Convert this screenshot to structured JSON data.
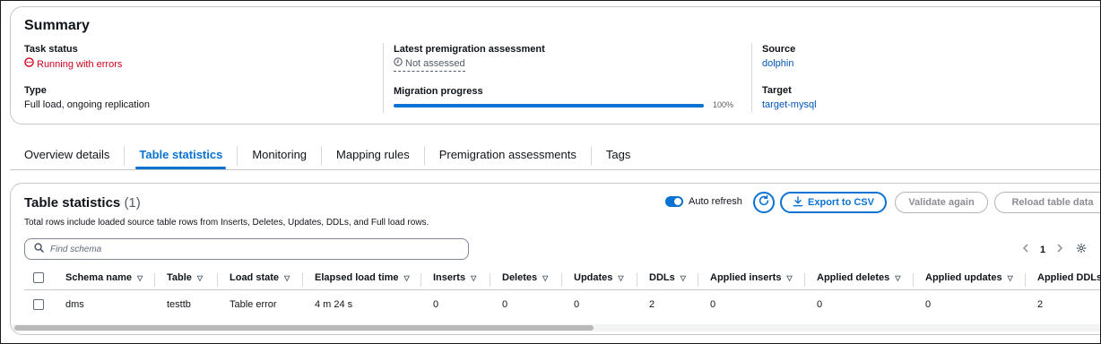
{
  "summary": {
    "title": "Summary",
    "task_status_label": "Task status",
    "task_status_value": "Running with errors",
    "type_label": "Type",
    "type_value": "Full load, ongoing replication",
    "premigration_label": "Latest premigration assessment",
    "premigration_value": "Not assessed",
    "migration_progress_label": "Migration progress",
    "migration_progress_percent": "100%",
    "migration_progress_fraction": 1.0,
    "source_label": "Source",
    "source_value": "dolphin",
    "target_label": "Target",
    "target_value": "target-mysql"
  },
  "tabs": [
    {
      "label": "Overview details",
      "active": false
    },
    {
      "label": "Table statistics",
      "active": true
    },
    {
      "label": "Monitoring",
      "active": false
    },
    {
      "label": "Mapping rules",
      "active": false
    },
    {
      "label": "Premigration assessments",
      "active": false
    },
    {
      "label": "Tags",
      "active": false
    }
  ],
  "table_stats": {
    "title": "Table statistics",
    "count": "(1)",
    "description": "Total rows include loaded source table rows from Inserts, Deletes, Updates, DDLs, and Full load rows.",
    "auto_refresh_label": "Auto refresh",
    "export_label": "Export to CSV",
    "validate_label": "Validate again",
    "reload_label": "Reload table data",
    "search_placeholder": "Find schema",
    "page_number": "1",
    "columns": [
      "Schema name",
      "Table",
      "Load state",
      "Elapsed load time",
      "Inserts",
      "Deletes",
      "Updates",
      "DDLs",
      "Applied inserts",
      "Applied deletes",
      "Applied updates",
      "Applied DDLs"
    ],
    "rows": [
      [
        "dms",
        "testtb",
        "Table error",
        "4 m 24 s",
        "0",
        "0",
        "0",
        "2",
        "0",
        "0",
        "0",
        "2"
      ]
    ]
  },
  "colors": {
    "accent": "#0972d3",
    "error": "#d1001c",
    "link": "#0055b8"
  },
  "icons": [
    "status-error-icon",
    "clock-icon",
    "refresh-icon",
    "download-icon",
    "search-icon",
    "chevron-left-icon",
    "chevron-right-icon",
    "settings-icon",
    "sort-caret-icon"
  ]
}
